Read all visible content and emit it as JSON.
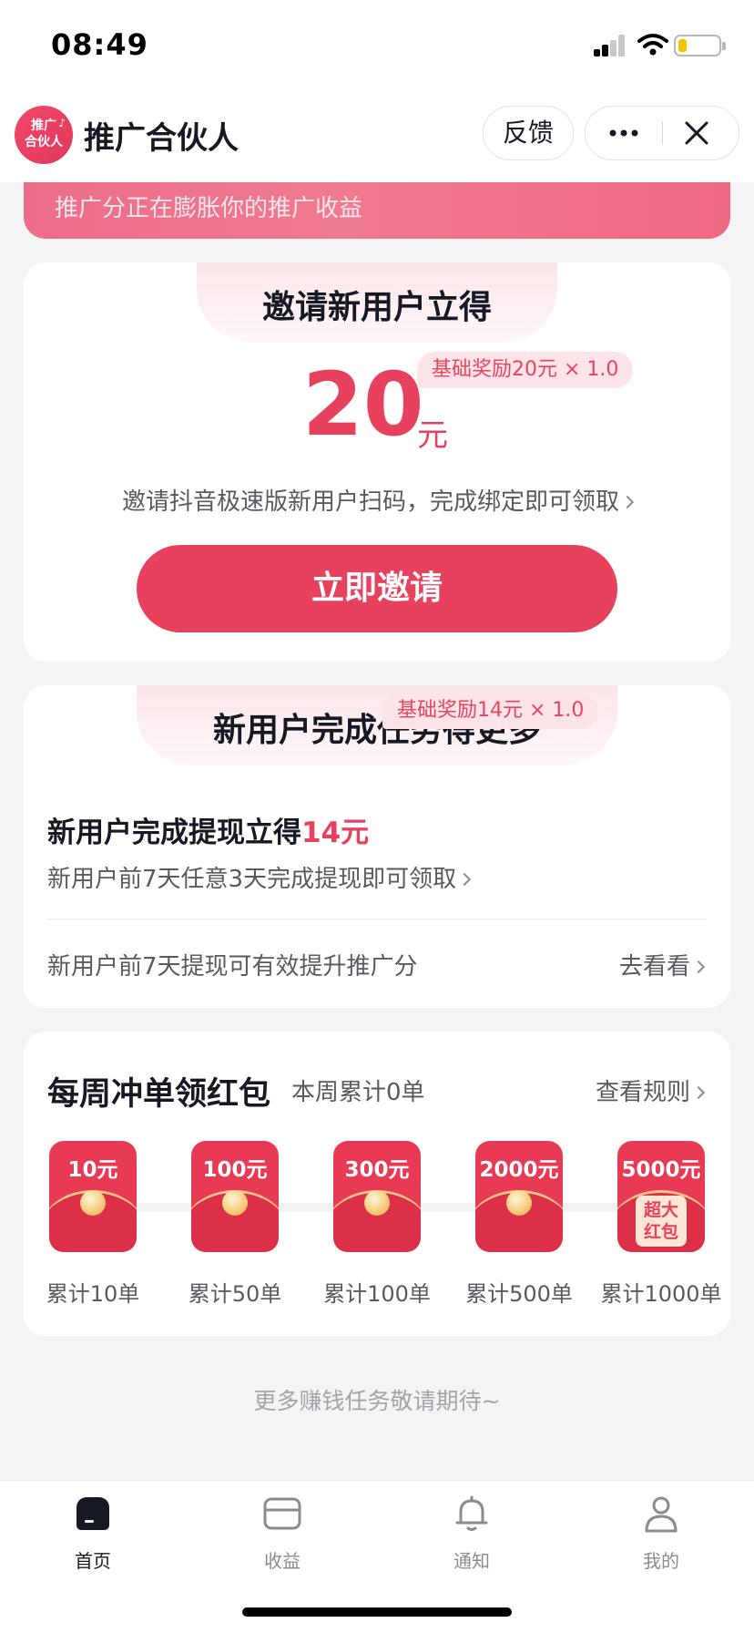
{
  "status_bar": {
    "time": "08:49"
  },
  "nav": {
    "logo_text_line1": "推广",
    "logo_text_line2": "合伙人",
    "title": "推广合伙人",
    "feedback": "反馈"
  },
  "banner": {
    "text": "推广分正在膨胀你的推广收益"
  },
  "invite_card": {
    "title": "邀请新用户立得",
    "badge": "基础奖励20元 × 1.0",
    "amount": "20",
    "unit": "元",
    "description": "邀请抖音极速版新用户扫码，完成绑定即可领取",
    "button": "立即邀请"
  },
  "task_card": {
    "title": "新用户完成任务得更多",
    "item_title": "新用户完成提现立得",
    "item_amount": "14元",
    "badge": "基础奖励14元 × 1.0",
    "item_desc": "新用户前7天任意3天完成提现即可领取",
    "tip": "新用户前7天提现可有效提升推广分",
    "link": "去看看"
  },
  "weekly_card": {
    "title": "每周冲单领红包",
    "count": "本周累计0单",
    "rule_link": "查看规则",
    "rewards": [
      {
        "value": "10元",
        "label": "累计10单"
      },
      {
        "value": "100元",
        "label": "累计50单"
      },
      {
        "value": "300元",
        "label": "累计100单"
      },
      {
        "value": "2000元",
        "label": "累计500单"
      },
      {
        "value": "5000元",
        "label": "累计1000单",
        "bonus_line1": "超大",
        "bonus_line2": "红包"
      }
    ]
  },
  "footer_note": "更多赚钱任务敬请期待~",
  "tab_bar": {
    "tabs": [
      {
        "label": "首页",
        "icon": "home-icon",
        "active": true
      },
      {
        "label": "收益",
        "icon": "wallet-icon",
        "active": false
      },
      {
        "label": "通知",
        "icon": "bell-icon",
        "active": false
      },
      {
        "label": "我的",
        "icon": "person-icon",
        "active": false
      }
    ]
  },
  "colors": {
    "accent": "#e8415d",
    "background": "#f4f4f6",
    "text": "#161823",
    "secondary_text": "#595a61"
  }
}
